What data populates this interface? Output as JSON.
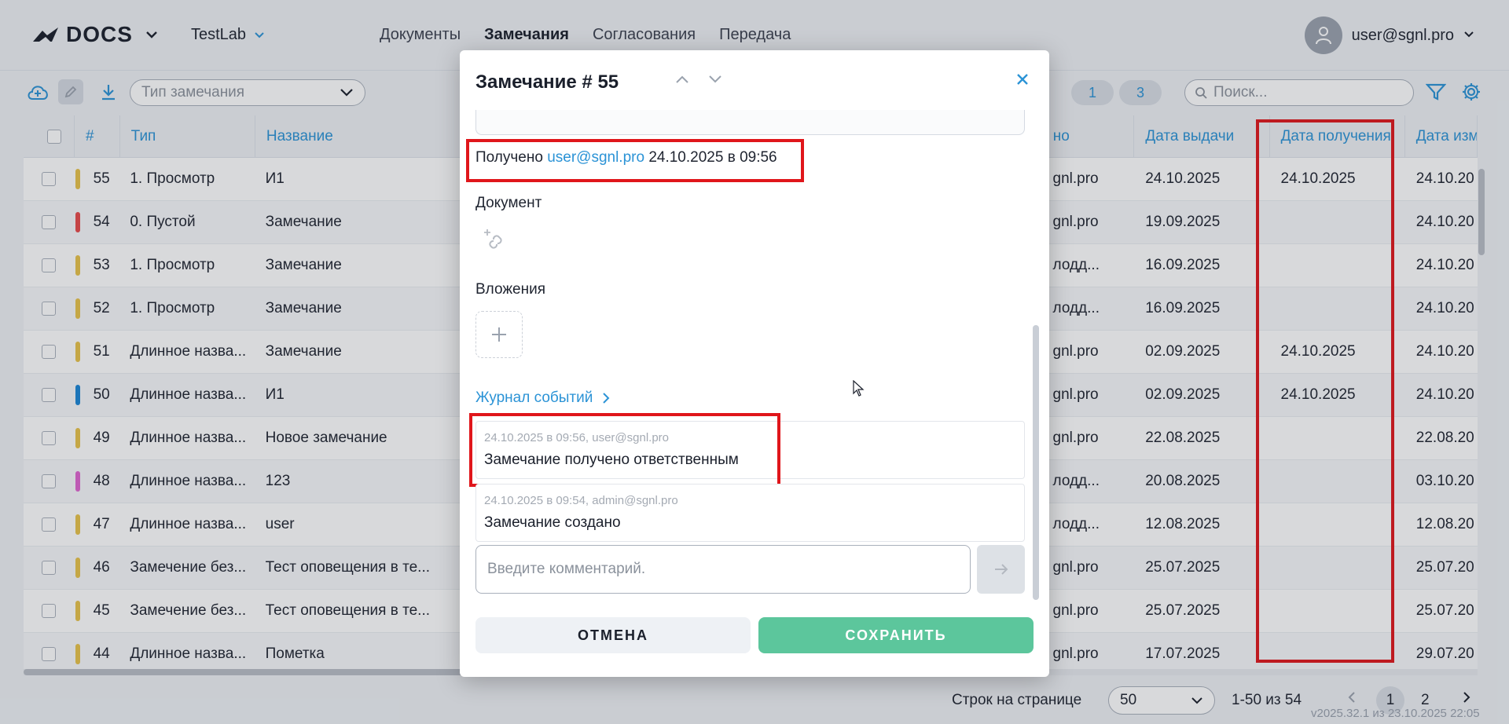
{
  "header": {
    "logo_text": "DOCS",
    "project": "TestLab",
    "nav": [
      "Документы",
      "Замечания",
      "Согласования",
      "Передача"
    ],
    "active_nav": "Замечания",
    "user": "user@sgnl.pro"
  },
  "toolbar": {
    "type_placeholder": "Тип замечания",
    "counters": [
      "1",
      "3"
    ],
    "search_placeholder": "Поиск..."
  },
  "table": {
    "columns": {
      "num": "#",
      "type": "Тип",
      "name": "Название",
      "responsible": "но",
      "issue_date": "Дата выдачи",
      "received_date": "Дата получения",
      "changed_date": "Дата изм"
    },
    "rows": [
      {
        "num": "55",
        "color": "#e8c24a",
        "type": "1. Просмотр",
        "name": "И1",
        "resp": "gnl.pro",
        "issue": "24.10.2025",
        "recv": "24.10.2025",
        "chg": "24.10.20"
      },
      {
        "num": "54",
        "color": "#e84a4a",
        "type": "0. Пустой",
        "name": "Замечание",
        "resp": "gnl.pro",
        "issue": "19.09.2025",
        "recv": "",
        "chg": "24.10.20"
      },
      {
        "num": "53",
        "color": "#e8c24a",
        "type": "1. Просмотр",
        "name": "Замечание",
        "resp": "лодд...",
        "issue": "16.09.2025",
        "recv": "",
        "chg": "24.10.20"
      },
      {
        "num": "52",
        "color": "#e8c24a",
        "type": "1. Просмотр",
        "name": "Замечание",
        "resp": "лодд...",
        "issue": "16.09.2025",
        "recv": "",
        "chg": "24.10.20"
      },
      {
        "num": "51",
        "color": "#e8c24a",
        "type": "Длинное назва...",
        "name": "Замечание",
        "resp": "gnl.pro",
        "issue": "02.09.2025",
        "recv": "24.10.2025",
        "chg": "24.10.20"
      },
      {
        "num": "50",
        "color": "#1a85d6",
        "type": "Длинное назва...",
        "name": "И1",
        "resp": "gnl.pro",
        "issue": "02.09.2025",
        "recv": "24.10.2025",
        "chg": "24.10.20"
      },
      {
        "num": "49",
        "color": "#e8c24a",
        "type": "Длинное назва...",
        "name": "Новое замечание",
        "resp": "gnl.pro",
        "issue": "22.08.2025",
        "recv": "",
        "chg": "22.08.20"
      },
      {
        "num": "48",
        "color": "#e064d0",
        "type": "Длинное назва...",
        "name": "123",
        "resp": "лодд...",
        "issue": "20.08.2025",
        "recv": "",
        "chg": "03.10.20"
      },
      {
        "num": "47",
        "color": "#e8c24a",
        "type": "Длинное назва...",
        "name": "user",
        "resp": "лодд...",
        "issue": "12.08.2025",
        "recv": "",
        "chg": "12.08.20"
      },
      {
        "num": "46",
        "color": "#e8c24a",
        "type": "Замечение без...",
        "name": "Тест оповещения в те...",
        "resp": "gnl.pro",
        "issue": "25.07.2025",
        "recv": "",
        "chg": "25.07.20"
      },
      {
        "num": "45",
        "color": "#e8c24a",
        "type": "Замечение без...",
        "name": "Тест оповещения в те...",
        "resp": "gnl.pro",
        "issue": "25.07.2025",
        "recv": "",
        "chg": "25.07.20"
      },
      {
        "num": "44",
        "color": "#e8c24a",
        "type": "Длинное назва...",
        "name": "Пометка",
        "resp": "gnl.pro",
        "issue": "17.07.2025",
        "recv": "",
        "chg": "29.07.20"
      }
    ]
  },
  "footer": {
    "rows_label": "Строк на странице",
    "rows_value": "50",
    "range": "1-50 из 54",
    "pages": [
      "1",
      "2"
    ],
    "current_page": "1",
    "version": "v2025.32.1 из 23.10.2025 22:05"
  },
  "modal": {
    "title": "Замечание # 55",
    "received_prefix": "Получено",
    "received_user": "user@sgnl.pro",
    "received_date": "24.10.2025 в 09:56",
    "document_label": "Документ",
    "attachments_label": "Вложения",
    "journal_label": "Журнал событий",
    "events": [
      {
        "meta": "24.10.2025 в 09:56, user@sgnl.pro",
        "text": "Замечание получено ответственным"
      },
      {
        "meta": "24.10.2025 в 09:54, admin@sgnl.pro",
        "text": "Замечание создано"
      }
    ],
    "comment_placeholder": "Введите комментарий.",
    "cancel_label": "ОТМЕНА",
    "save_label": "СОХРАНИТЬ"
  }
}
